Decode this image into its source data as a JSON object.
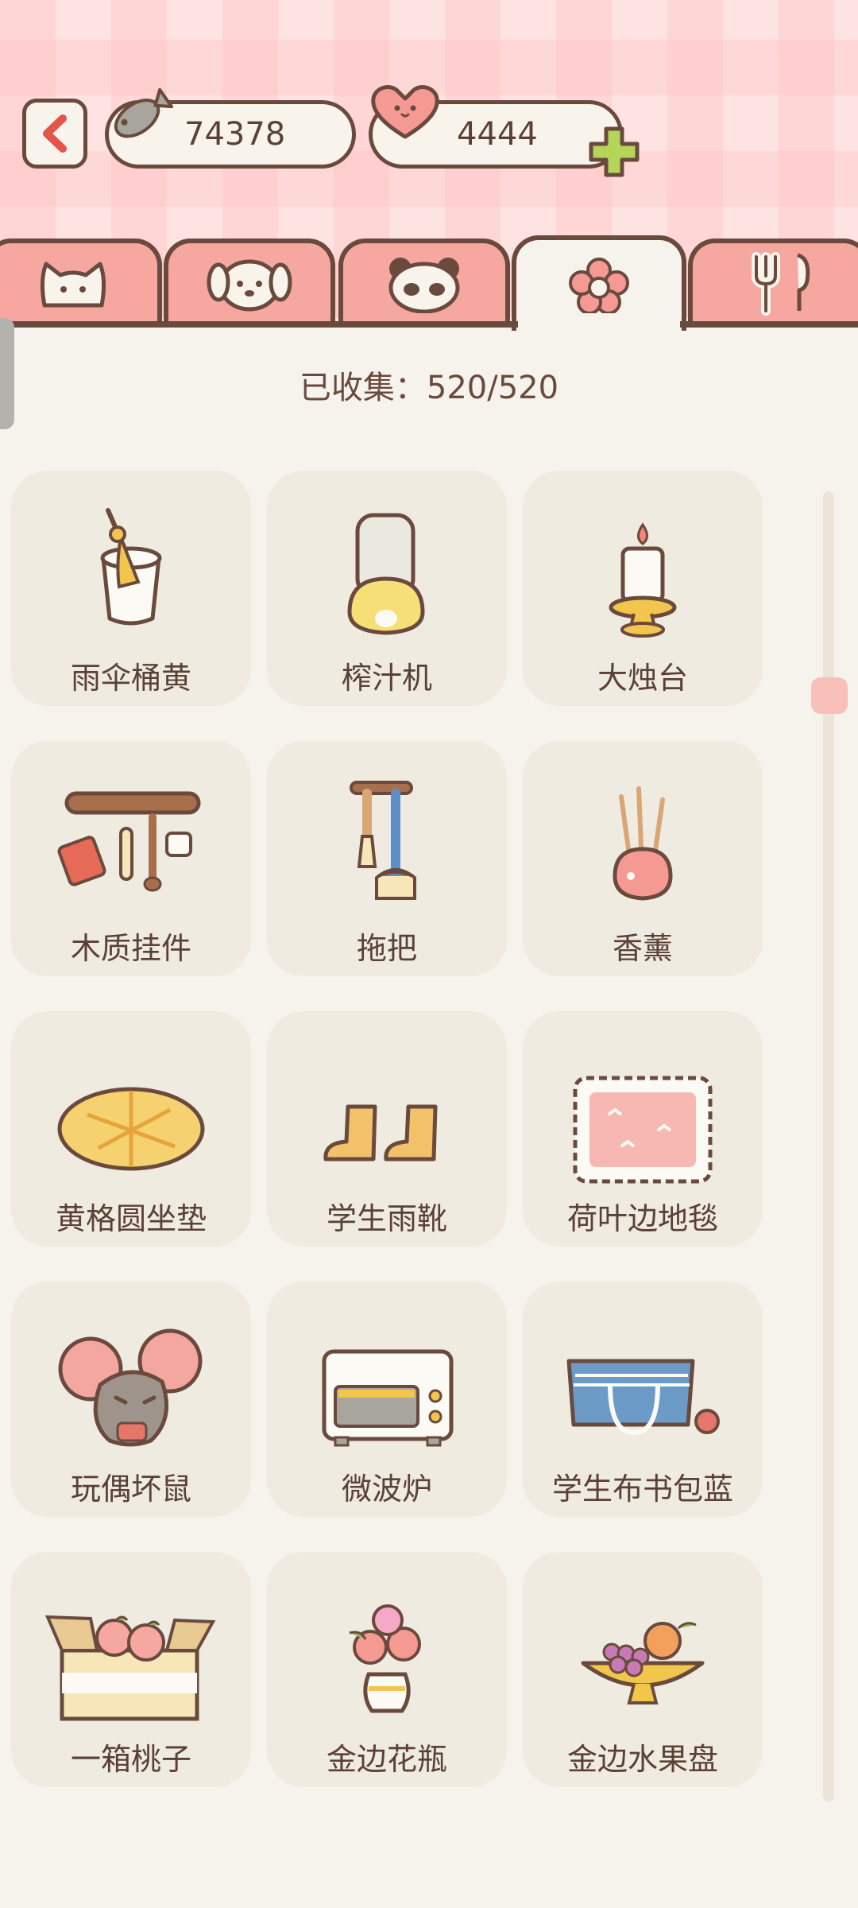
{
  "header": {
    "fish_count": "74378",
    "heart_count": "4444"
  },
  "tabs": [
    {
      "icon": "cat-face-icon",
      "active": false
    },
    {
      "icon": "dog-face-icon",
      "active": false
    },
    {
      "icon": "panda-face-icon",
      "active": false
    },
    {
      "icon": "flower-icon",
      "active": true
    },
    {
      "icon": "fork-spoon-icon",
      "active": false
    }
  ],
  "collected_text": "已收集：520/520",
  "items": [
    {
      "label": "雨伞桶黄",
      "icon": "umbrella-bucket-icon"
    },
    {
      "label": "榨汁机",
      "icon": "juicer-icon"
    },
    {
      "label": "大烛台",
      "icon": "candlestick-icon"
    },
    {
      "label": "木质挂件",
      "icon": "wooden-hanger-icon"
    },
    {
      "label": "拖把",
      "icon": "mop-icon"
    },
    {
      "label": "香薰",
      "icon": "incense-icon"
    },
    {
      "label": "黄格圆坐垫",
      "icon": "round-cushion-icon"
    },
    {
      "label": "学生雨靴",
      "icon": "rain-boots-icon"
    },
    {
      "label": "荷叶边地毯",
      "icon": "ruffled-rug-icon"
    },
    {
      "label": "玩偶坏鼠",
      "icon": "mouse-doll-icon"
    },
    {
      "label": "微波炉",
      "icon": "microwave-icon"
    },
    {
      "label": "学生布书包蓝",
      "icon": "school-bag-icon"
    },
    {
      "label": "一箱桃子",
      "icon": "peach-box-icon"
    },
    {
      "label": "金边花瓶",
      "icon": "flower-vase-icon"
    },
    {
      "label": "金边水果盘",
      "icon": "fruit-plate-icon"
    }
  ],
  "colors": {
    "outline": "#6b4a3e",
    "tab_pink": "#f6a7a0",
    "card_bg": "#efebe0",
    "page_bg": "#f5f3ec",
    "accent_green": "#b5d55a"
  }
}
